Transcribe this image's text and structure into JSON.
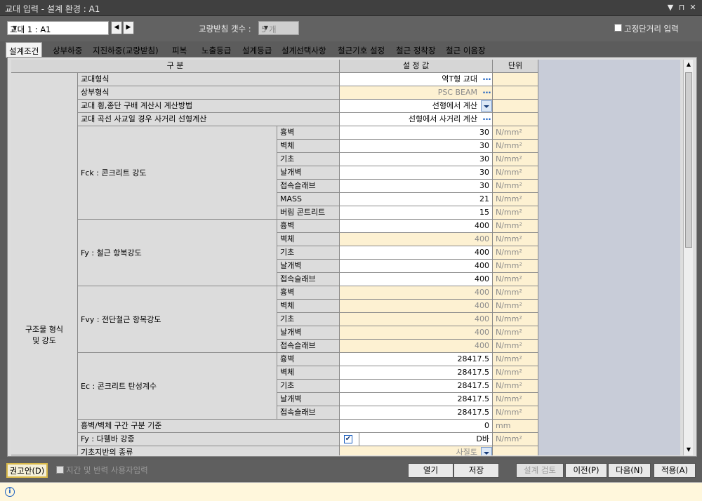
{
  "window": {
    "title": "교대 입력 - 설계 환경 : A1"
  },
  "toolbar": {
    "abutment_value": "교대 1 : A1",
    "bearing_label": "교량받침 갯수 :",
    "bearing_value": "5 개",
    "fixed_label": "고정단거리 입력"
  },
  "tabs": [
    "설계조건",
    "상부하중",
    "지진하중(교량받침)",
    "피복",
    "노출등급",
    "설계등급",
    "설계선택사항",
    "철근기호 설정",
    "철근 정착장",
    "철근 이음장"
  ],
  "grid": {
    "headers": {
      "category": "구 분",
      "value": "설 정 값",
      "unit": "단위"
    },
    "group_label": "구조물 형식\n및 강도",
    "rows": {
      "r1": {
        "label": "교대형식",
        "value": "역T형 교대"
      },
      "r2": {
        "label": "상부형식",
        "value": "PSC BEAM"
      },
      "r3": {
        "label": "교대 횡,종단 구배 계산시 계산방법",
        "value": "선형에서 계산"
      },
      "r4": {
        "label": "교대 곡선 사교일 경우 사거리 선형계산",
        "value": "선형에서 사거리 계산"
      }
    },
    "fck": {
      "label": "Fck : 콘크리트 강도",
      "items": [
        [
          "흉벽",
          "30",
          "N/mm²"
        ],
        [
          "벽체",
          "30",
          "N/mm²"
        ],
        [
          "기초",
          "30",
          "N/mm²"
        ],
        [
          "날개벽",
          "30",
          "N/mm²"
        ],
        [
          "접속슬래브",
          "30",
          "N/mm²"
        ],
        [
          "MASS",
          "21",
          "N/mm²"
        ],
        [
          "버림 콘트리트",
          "15",
          "N/mm²"
        ]
      ]
    },
    "fy": {
      "label": "Fy : 철근 항복강도",
      "items": [
        [
          "흉벽",
          "400",
          "N/mm²"
        ],
        [
          "벽체",
          "400",
          "N/mm²"
        ],
        [
          "기초",
          "400",
          "N/mm²"
        ],
        [
          "날개벽",
          "400",
          "N/mm²"
        ],
        [
          "접속슬래브",
          "400",
          "N/mm²"
        ]
      ]
    },
    "fvy": {
      "label": "Fvy : 전단철근 항복강도",
      "items": [
        [
          "흉벽",
          "400",
          "N/mm²"
        ],
        [
          "벽체",
          "400",
          "N/mm²"
        ],
        [
          "기초",
          "400",
          "N/mm²"
        ],
        [
          "날개벽",
          "400",
          "N/mm²"
        ],
        [
          "접속슬래브",
          "400",
          "N/mm²"
        ]
      ]
    },
    "ec": {
      "label": "Ec : 콘크리트 탄성계수",
      "items": [
        [
          "흉벽",
          "28417.5",
          "N/mm²"
        ],
        [
          "벽체",
          "28417.5",
          "N/mm²"
        ],
        [
          "기초",
          "28417.5",
          "N/mm²"
        ],
        [
          "날개벽",
          "28417.5",
          "N/mm²"
        ],
        [
          "접속슬래브",
          "28417.5",
          "N/mm²"
        ]
      ]
    },
    "tail": {
      "t1": {
        "label": "흉벽/벽체 구간 구분 기준",
        "value": "0",
        "unit": "mm"
      },
      "t2": {
        "label": "Fy : 다웰바 강종",
        "value": "D바",
        "unit": "N/mm²"
      },
      "t3": {
        "label": "기초지반의 종류",
        "value": "사질토"
      }
    }
  },
  "buttons": {
    "recommend": "권고안(D)",
    "span_label": "지간 및 반력 사용자입력",
    "open": "열기",
    "save": "저장",
    "check": "설계 검토",
    "prev": "이전(P)",
    "next": "다음(N)",
    "apply": "적용(A)"
  },
  "colors": {
    "editable_yellow": "#fdf1d2",
    "link_blue": "#1a5fc0"
  }
}
